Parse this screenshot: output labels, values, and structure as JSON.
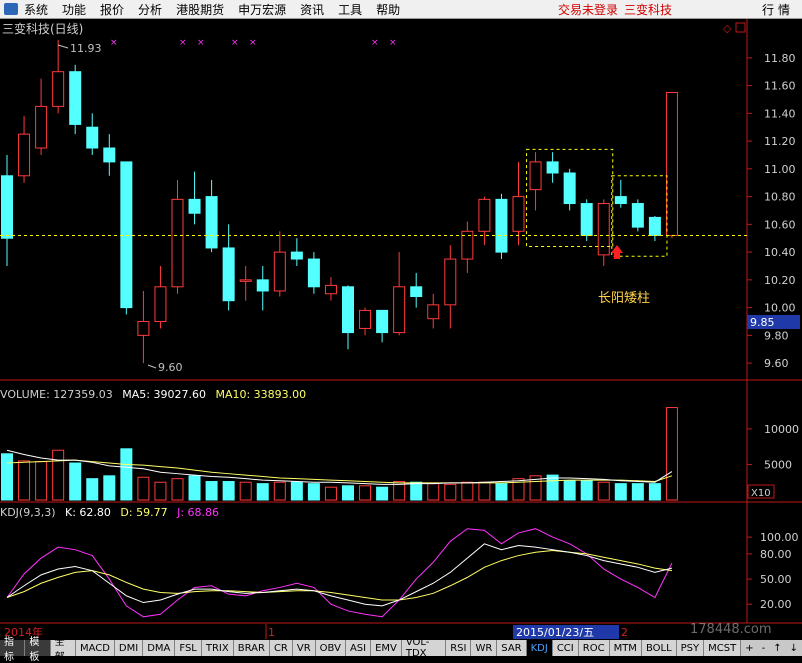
{
  "menu": {
    "items": [
      "系统",
      "功能",
      "报价",
      "分析",
      "港股期货",
      "申万宏源",
      "资讯",
      "工具",
      "帮助"
    ],
    "login_status": "交易未登录",
    "stock_name": "三变科技",
    "quote_button": "行情"
  },
  "chart_title": "三变科技(日线)",
  "price_axis": [
    "11.80",
    "11.60",
    "11.40",
    "11.20",
    "11.00",
    "10.80",
    "10.60",
    "10.40",
    "10.20",
    "10.00",
    "9.80",
    "9.60"
  ],
  "current_price_tag": "9.85",
  "annotations": {
    "high_label": "11.93",
    "low_label": "9.60",
    "pattern_label": "长阳矮柱"
  },
  "volume_header": {
    "volume": "VOLUME: 127359.03",
    "ma5": "MA5: 39027.60",
    "ma10": "MA10: 33893.00"
  },
  "volume_axis": [
    "10000",
    "5000"
  ],
  "volume_unit": "X10",
  "kdj_header": {
    "name": "KDJ(9,3,3)",
    "k": "K: 62.80",
    "d": "D: 59.77",
    "j": "J: 68.86"
  },
  "kdj_axis": [
    "100.00",
    "80.00",
    "50.00",
    "20.00"
  ],
  "date_axis": {
    "year_label": "2014年",
    "month1": "1",
    "cursor_date": "2015/01/23/五",
    "month2": "2"
  },
  "tabs": [
    "指标",
    "模板",
    "全部",
    "MACD",
    "DMI",
    "DMA",
    "FSL",
    "TRIX",
    "BRAR",
    "CR",
    "VR",
    "OBV",
    "ASI",
    "EMV",
    "VOL-TDX",
    "RSI",
    "WR",
    "SAR",
    "KDJ",
    "CCI",
    "ROC",
    "MTM",
    "BOLL",
    "PSY",
    "MCST"
  ],
  "active_tab": "KDJ",
  "tab_controls": [
    "+",
    "-",
    "↑",
    "↓"
  ],
  "watermark": "178448.com",
  "colors": {
    "up": "#ff3b3b",
    "down": "#54ffff",
    "ma5": "#ffffff",
    "ma10": "#ffff66",
    "j": "#ff33ff",
    "guide": "#ffff00"
  },
  "chart_data": {
    "type": "candlestick",
    "price_range": [
      9.5,
      11.95
    ],
    "candles": [
      {
        "o": 10.95,
        "c": 10.5,
        "h": 11.1,
        "l": 10.3
      },
      {
        "o": 10.95,
        "c": 11.25,
        "h": 11.38,
        "l": 10.9
      },
      {
        "o": 11.15,
        "c": 11.45,
        "h": 11.65,
        "l": 11.1
      },
      {
        "o": 11.45,
        "c": 11.7,
        "h": 11.93,
        "l": 11.4
      },
      {
        "o": 11.7,
        "c": 11.32,
        "h": 11.75,
        "l": 11.25
      },
      {
        "o": 11.3,
        "c": 11.15,
        "h": 11.4,
        "l": 11.1
      },
      {
        "o": 11.15,
        "c": 11.05,
        "h": 11.25,
        "l": 10.95
      },
      {
        "o": 11.05,
        "c": 10.0,
        "h": 11.05,
        "l": 9.95
      },
      {
        "o": 9.8,
        "c": 9.9,
        "h": 10.12,
        "l": 9.6
      },
      {
        "o": 9.9,
        "c": 10.15,
        "h": 10.3,
        "l": 9.85
      },
      {
        "o": 10.15,
        "c": 10.78,
        "h": 10.92,
        "l": 10.1
      },
      {
        "o": 10.78,
        "c": 10.68,
        "h": 10.98,
        "l": 10.6
      },
      {
        "o": 10.8,
        "c": 10.43,
        "h": 10.92,
        "l": 10.4
      },
      {
        "o": 10.43,
        "c": 10.05,
        "h": 10.6,
        "l": 9.98
      },
      {
        "o": 10.2,
        "c": 10.2,
        "h": 10.3,
        "l": 10.05
      },
      {
        "o": 10.2,
        "c": 10.12,
        "h": 10.3,
        "l": 9.98
      },
      {
        "o": 10.12,
        "c": 10.4,
        "h": 10.55,
        "l": 10.08
      },
      {
        "o": 10.4,
        "c": 10.35,
        "h": 10.5,
        "l": 10.3
      },
      {
        "o": 10.35,
        "c": 10.15,
        "h": 10.4,
        "l": 10.1
      },
      {
        "o": 10.1,
        "c": 10.16,
        "h": 10.22,
        "l": 10.05
      },
      {
        "o": 10.15,
        "c": 9.82,
        "h": 10.16,
        "l": 9.7
      },
      {
        "o": 9.85,
        "c": 9.98,
        "h": 10.0,
        "l": 9.8
      },
      {
        "o": 9.98,
        "c": 9.82,
        "h": 9.98,
        "l": 9.75
      },
      {
        "o": 9.82,
        "c": 10.15,
        "h": 10.4,
        "l": 9.8
      },
      {
        "o": 10.15,
        "c": 10.08,
        "h": 10.25,
        "l": 10.0
      },
      {
        "o": 9.92,
        "c": 10.02,
        "h": 10.1,
        "l": 9.85
      },
      {
        "o": 10.02,
        "c": 10.35,
        "h": 10.45,
        "l": 9.85
      },
      {
        "o": 10.35,
        "c": 10.55,
        "h": 10.62,
        "l": 10.25
      },
      {
        "o": 10.55,
        "c": 10.78,
        "h": 10.8,
        "l": 10.45
      },
      {
        "o": 10.78,
        "c": 10.4,
        "h": 10.82,
        "l": 10.35
      },
      {
        "o": 10.55,
        "c": 10.8,
        "h": 11.05,
        "l": 10.45
      },
      {
        "o": 10.85,
        "c": 11.05,
        "h": 11.12,
        "l": 10.7
      },
      {
        "o": 11.05,
        "c": 10.97,
        "h": 11.12,
        "l": 10.9
      },
      {
        "o": 10.97,
        "c": 10.75,
        "h": 11.0,
        "l": 10.7
      },
      {
        "o": 10.75,
        "c": 10.52,
        "h": 10.78,
        "l": 10.48
      },
      {
        "o": 10.38,
        "c": 10.75,
        "h": 10.78,
        "l": 10.3
      },
      {
        "o": 10.8,
        "c": 10.75,
        "h": 10.92,
        "l": 10.72
      },
      {
        "o": 10.75,
        "c": 10.58,
        "h": 10.78,
        "l": 10.55
      },
      {
        "o": 10.65,
        "c": 10.52,
        "h": 10.66,
        "l": 10.48
      },
      {
        "o": 10.52,
        "c": 11.55,
        "h": 11.55,
        "l": 10.5
      }
    ],
    "volume_range": [
      0,
      13500
    ],
    "volumes": [
      6500,
      5500,
      5400,
      7000,
      5200,
      3000,
      3400,
      7200,
      3200,
      2500,
      3000,
      3400,
      2600,
      2600,
      2500,
      2300,
      2500,
      2500,
      2300,
      1800,
      2000,
      2000,
      1800,
      2600,
      2500,
      2300,
      2200,
      2500,
      2500,
      2300,
      3000,
      3400,
      3500,
      2700,
      2700,
      2500,
      2300,
      2300,
      2300,
      13000
    ],
    "ma5": [
      7000,
      6400,
      5900,
      5600,
      5600,
      5300,
      4800,
      4600,
      4400,
      3900,
      3700,
      3500,
      3300,
      3200,
      3000,
      2800,
      2700,
      2600,
      2500,
      2500,
      2400,
      2300,
      2200,
      2200,
      2300,
      2300,
      2400,
      2400,
      2500,
      2600,
      2700,
      2900,
      3100,
      3100,
      3000,
      2900,
      2700,
      2600,
      2500,
      4000
    ],
    "ma10": [
      5200,
      5300,
      5400,
      5500,
      5600,
      5400,
      5200,
      5000,
      4900,
      4700,
      4500,
      4200,
      3900,
      3700,
      3500,
      3300,
      3100,
      3000,
      2900,
      2800,
      2700,
      2600,
      2500,
      2400,
      2400,
      2400,
      2400,
      2400,
      2400,
      2400,
      2500,
      2600,
      2700,
      2800,
      2800,
      2800,
      2800,
      2700,
      2600,
      3400
    ],
    "kdj_range": [
      0,
      118
    ],
    "k": [
      28,
      42,
      55,
      62,
      65,
      60,
      45,
      30,
      22,
      25,
      32,
      38,
      38,
      35,
      33,
      34,
      36,
      38,
      36,
      30,
      25,
      20,
      18,
      25,
      35,
      45,
      58,
      75,
      92,
      85,
      90,
      88,
      85,
      82,
      78,
      72,
      68,
      64,
      58,
      63
    ],
    "d": [
      28,
      35,
      45,
      52,
      58,
      60,
      55,
      46,
      38,
      34,
      33,
      35,
      36,
      36,
      35,
      34,
      35,
      36,
      36,
      34,
      31,
      28,
      25,
      25,
      28,
      33,
      42,
      52,
      64,
      72,
      78,
      82,
      84,
      82,
      80,
      76,
      72,
      68,
      63,
      60
    ],
    "j": [
      28,
      56,
      75,
      88,
      85,
      78,
      50,
      18,
      5,
      8,
      25,
      40,
      42,
      32,
      30,
      36,
      40,
      45,
      40,
      20,
      12,
      8,
      5,
      25,
      50,
      70,
      95,
      110,
      108,
      92,
      105,
      110,
      100,
      92,
      80,
      62,
      50,
      40,
      28,
      69
    ],
    "x_tick_labels": [
      "2014年",
      "1",
      "2015/01/23/五",
      "2"
    ]
  }
}
